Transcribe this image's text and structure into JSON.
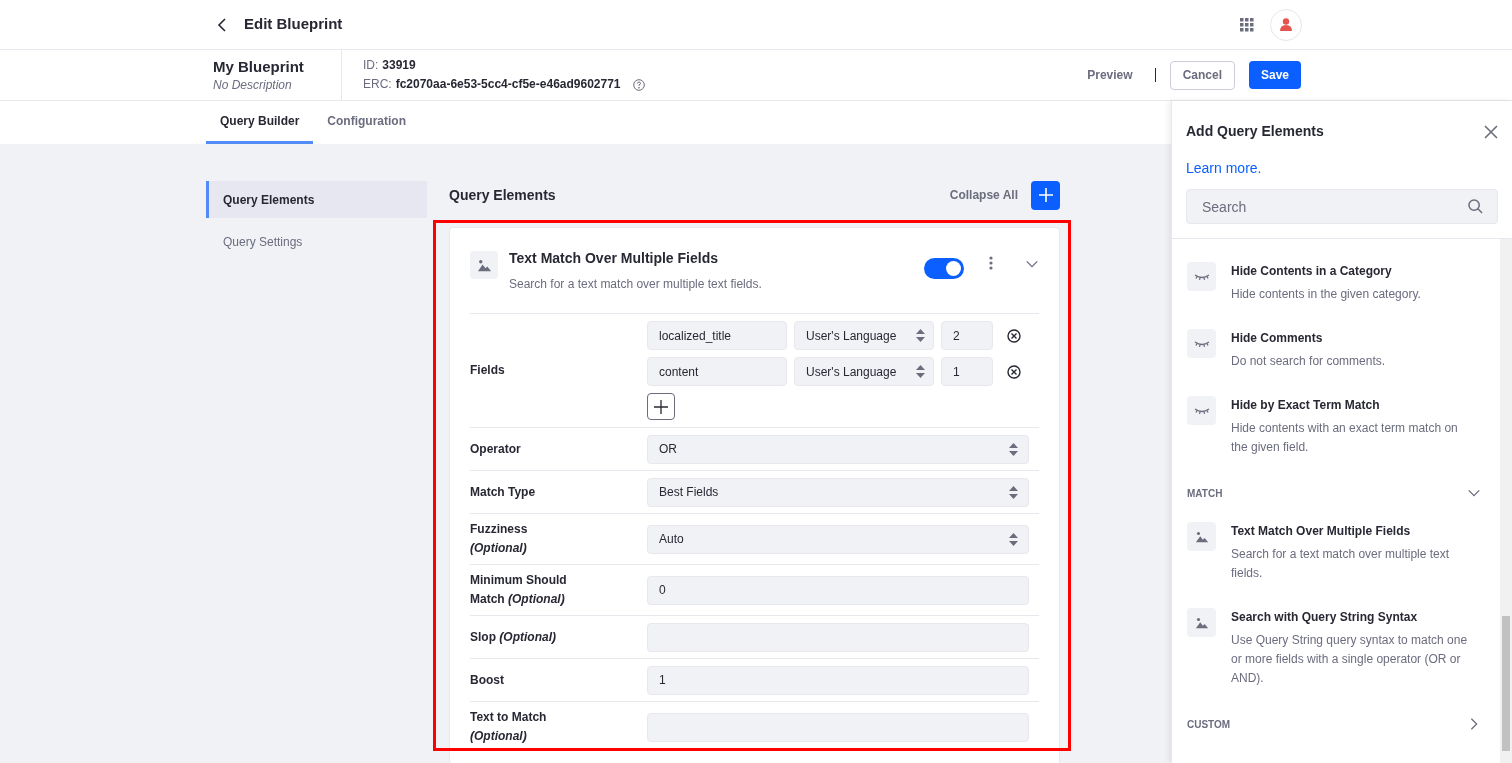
{
  "topbar": {
    "title": "Edit Blueprint"
  },
  "header": {
    "name": "My Blueprint",
    "description": "No Description",
    "id_label": "ID:",
    "id_value": "33919",
    "erc_label": "ERC:",
    "erc_value": "fc2070aa-6e53-5cc4-cf5e-e46ad9602771",
    "actions": {
      "preview": "Preview",
      "cancel": "Cancel",
      "save": "Save"
    }
  },
  "tabs": [
    {
      "label": "Query Builder",
      "selected": true
    },
    {
      "label": "Configuration",
      "selected": false
    }
  ],
  "sidebar": {
    "items": [
      {
        "label": "Query Elements",
        "selected": true
      },
      {
        "label": "Query Settings",
        "selected": false
      }
    ]
  },
  "main": {
    "title": "Query Elements",
    "collapse_all": "Collapse All",
    "element": {
      "title": "Text Match Over Multiple Fields",
      "description": "Search for a text match over multiple text fields.",
      "enabled": true,
      "expanded": true,
      "highlighted": true,
      "rows": [
        {
          "kind": "fields",
          "label": "Fields",
          "fields": [
            {
              "name": "localized_title",
              "language": "User's Language",
              "boost": "2"
            },
            {
              "name": "content",
              "language": "User's Language",
              "boost": "1"
            }
          ]
        },
        {
          "kind": "select",
          "label": "Operator",
          "value": "OR"
        },
        {
          "kind": "select",
          "label": "Match Type",
          "value": "Best Fields"
        },
        {
          "kind": "select",
          "label": "Fuzziness *(Optional)*",
          "value": "Auto"
        },
        {
          "kind": "input",
          "label": "Minimum Should Match *(Optional)*",
          "value": "0"
        },
        {
          "kind": "input",
          "label": "Slop *(Optional)*"
        },
        {
          "kind": "input",
          "label": "Boost",
          "value": "1"
        },
        {
          "kind": "input",
          "label": "Text to Match *(Optional)*"
        }
      ]
    }
  },
  "panel": {
    "title": "Add Query Elements",
    "link": "Learn more.",
    "search": {
      "placeholder": "Search"
    },
    "groups": [
      {
        "items": [
          {
            "kind": "hide",
            "title": "Hide Contents in a Category",
            "description": "Hide contents in the given category."
          },
          {
            "kind": "hide",
            "title": "Hide Comments",
            "description": "Do not search for comments."
          },
          {
            "kind": "hide",
            "title": "Hide by Exact Term Match",
            "description": "Hide contents with an exact term match on the given field."
          }
        ]
      },
      {
        "title": "MATCH",
        "expanded": true,
        "items": [
          {
            "kind": "match",
            "title": "Text Match Over Multiple Fields",
            "description": "Search for a text match over multiple text fields."
          },
          {
            "kind": "match",
            "title": "Search with Query String Syntax",
            "description": "Use Query String query syntax to match one or more fields with a single operator (OR or AND)."
          }
        ]
      },
      {
        "title": "CUSTOM",
        "expanded": false
      }
    ]
  }
}
